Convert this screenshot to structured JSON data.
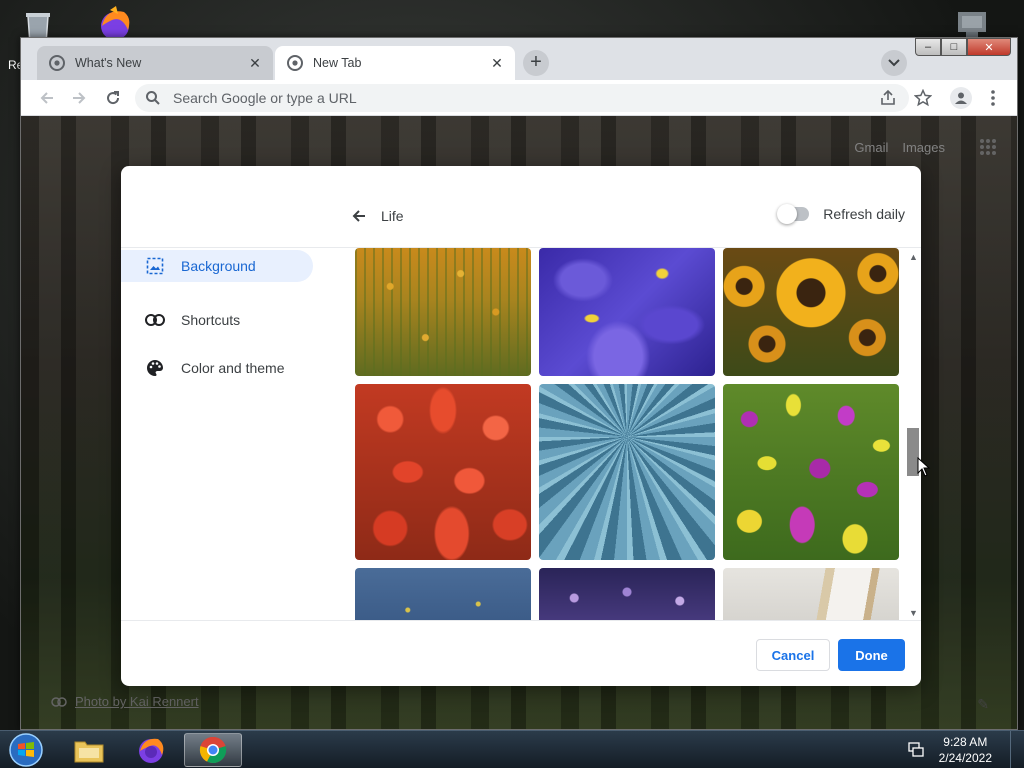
{
  "desktop": {
    "recycle_label": "Re"
  },
  "browser": {
    "tabs": [
      {
        "title": "What's New",
        "active": false
      },
      {
        "title": "New Tab",
        "active": true
      }
    ],
    "omnibox": {
      "placeholder": "Search Google or type a URL"
    }
  },
  "ntp": {
    "links": [
      "Gmail",
      "Images"
    ],
    "photo_credit": "Photo by Kai Rennert"
  },
  "dialog": {
    "title": "Life",
    "refresh_label": "Refresh daily",
    "refresh_on": false,
    "nav": [
      {
        "label": "Background",
        "icon": "image-icon",
        "selected": true
      },
      {
        "label": "Shortcuts",
        "icon": "link-icon",
        "selected": false
      },
      {
        "label": "Color and theme",
        "icon": "palette-icon",
        "selected": false
      }
    ],
    "thumbnails": [
      "yellow-flowers-field",
      "purple-iris",
      "sunflowers",
      "red-tulips",
      "blue-succulent",
      "purple-yellow-tulips",
      "blue-flowers",
      "purple-flower-field",
      "white-interior"
    ],
    "cancel_label": "Cancel",
    "done_label": "Done"
  },
  "taskbar": {
    "time": "9:28 AM",
    "date": "2/24/2022"
  },
  "colors": {
    "accent": "#1a73e8",
    "selected_bg": "#e8f0fe"
  }
}
